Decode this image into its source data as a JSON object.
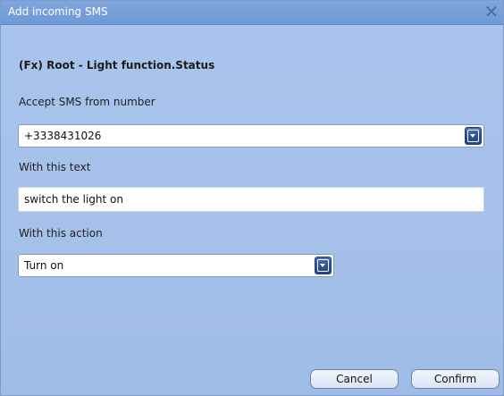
{
  "window": {
    "title": "Add incoming SMS",
    "close_glyph": "✕"
  },
  "heading": "(Fx) Root - Light function.Status",
  "fields": {
    "from_label": "Accept SMS from number",
    "from_value": "+3338431026",
    "text_label": "With this text",
    "text_value": "switch the light on",
    "action_label": "With this action",
    "action_value": "Turn on"
  },
  "buttons": {
    "cancel": "Cancel",
    "confirm": "Confirm"
  },
  "icons": {
    "close": "close-icon",
    "dropdown": "chevron-down-icon"
  },
  "colors": {
    "titlebar": "#7fa6dd",
    "background": "#a9c5ec",
    "dropdown_button": "#2e5299"
  }
}
